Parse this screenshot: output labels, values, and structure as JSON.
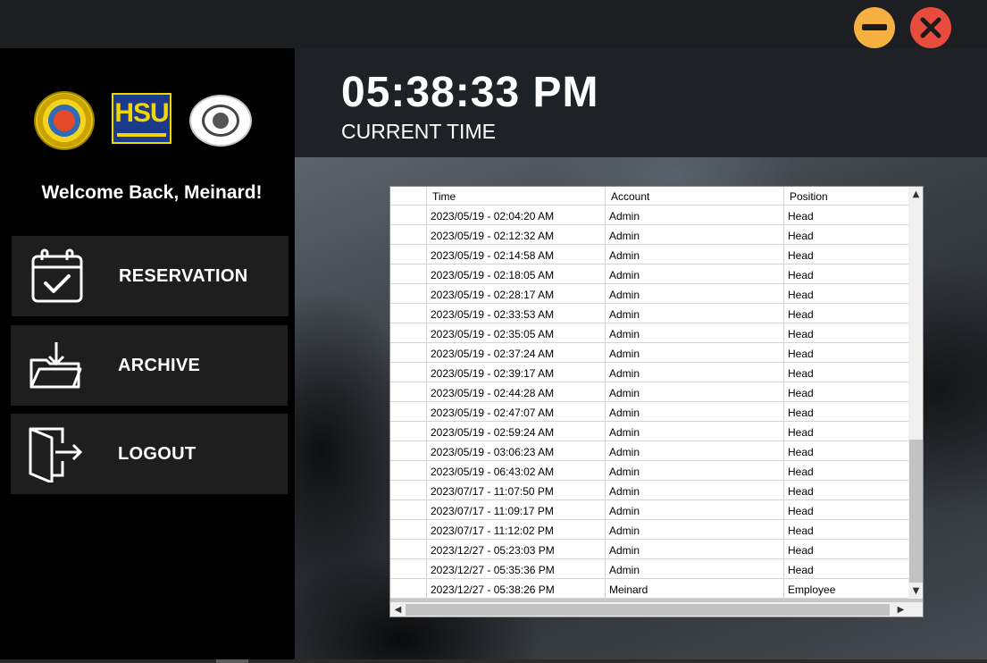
{
  "window": {
    "minimize_icon": "minimize-icon",
    "close_icon": "close-icon",
    "colors": {
      "minimize": "#f5b041",
      "close": "#e74c3c"
    }
  },
  "sidebar": {
    "logos": [
      "university-logo",
      "hsu-logo",
      "gym-logo"
    ],
    "hsu_logo_text": "HSU",
    "welcome": "Welcome Back, Meinard!",
    "nav": [
      {
        "label": "RESERVATION",
        "icon": "calendar-check-icon"
      },
      {
        "label": "ARCHIVE",
        "icon": "folder-download-icon"
      },
      {
        "label": "LOGOUT",
        "icon": "logout-door-icon"
      }
    ]
  },
  "header": {
    "time": "05:38:33 PM",
    "label": "CURRENT TIME"
  },
  "table": {
    "columns": [
      "",
      "Time",
      "Account",
      "Position"
    ],
    "rows": [
      {
        "time": "2023/05/19 - 02:04:20 AM",
        "account": "Admin",
        "position": "Head"
      },
      {
        "time": "2023/05/19 - 02:12:32 AM",
        "account": "Admin",
        "position": "Head"
      },
      {
        "time": "2023/05/19 - 02:14:58 AM",
        "account": "Admin",
        "position": "Head"
      },
      {
        "time": "2023/05/19 - 02:18:05 AM",
        "account": "Admin",
        "position": "Head"
      },
      {
        "time": "2023/05/19 - 02:28:17 AM",
        "account": "Admin",
        "position": "Head"
      },
      {
        "time": "2023/05/19 - 02:33:53 AM",
        "account": "Admin",
        "position": "Head"
      },
      {
        "time": "2023/05/19 - 02:35:05 AM",
        "account": "Admin",
        "position": "Head"
      },
      {
        "time": "2023/05/19 - 02:37:24 AM",
        "account": "Admin",
        "position": "Head"
      },
      {
        "time": "2023/05/19 - 02:39:17 AM",
        "account": "Admin",
        "position": "Head"
      },
      {
        "time": "2023/05/19 - 02:44:28 AM",
        "account": "Admin",
        "position": "Head"
      },
      {
        "time": "2023/05/19 - 02:47:07 AM",
        "account": "Admin",
        "position": "Head"
      },
      {
        "time": "2023/05/19 - 02:59:24 AM",
        "account": "Admin",
        "position": "Head"
      },
      {
        "time": "2023/05/19 - 03:06:23 AM",
        "account": "Admin",
        "position": "Head"
      },
      {
        "time": "2023/05/19 - 06:43:02 AM",
        "account": "Admin",
        "position": "Head"
      },
      {
        "time": "2023/07/17 - 11:07:50 PM",
        "account": "Admin",
        "position": "Head"
      },
      {
        "time": "2023/07/17 - 11:09:17 PM",
        "account": "Admin",
        "position": "Head"
      },
      {
        "time": "2023/07/17 - 11:12:02 PM",
        "account": "Admin",
        "position": "Head"
      },
      {
        "time": "2023/12/27 - 05:23:03 PM",
        "account": "Admin",
        "position": "Head"
      },
      {
        "time": "2023/12/27 - 05:35:36 PM",
        "account": "Admin",
        "position": "Head"
      },
      {
        "time": "2023/12/27 - 05:38:26 PM",
        "account": "Meinard",
        "position": "Employee"
      }
    ],
    "scroll_icons": {
      "up": "▲",
      "down": "▼",
      "left": "◀",
      "right": "▶"
    }
  }
}
